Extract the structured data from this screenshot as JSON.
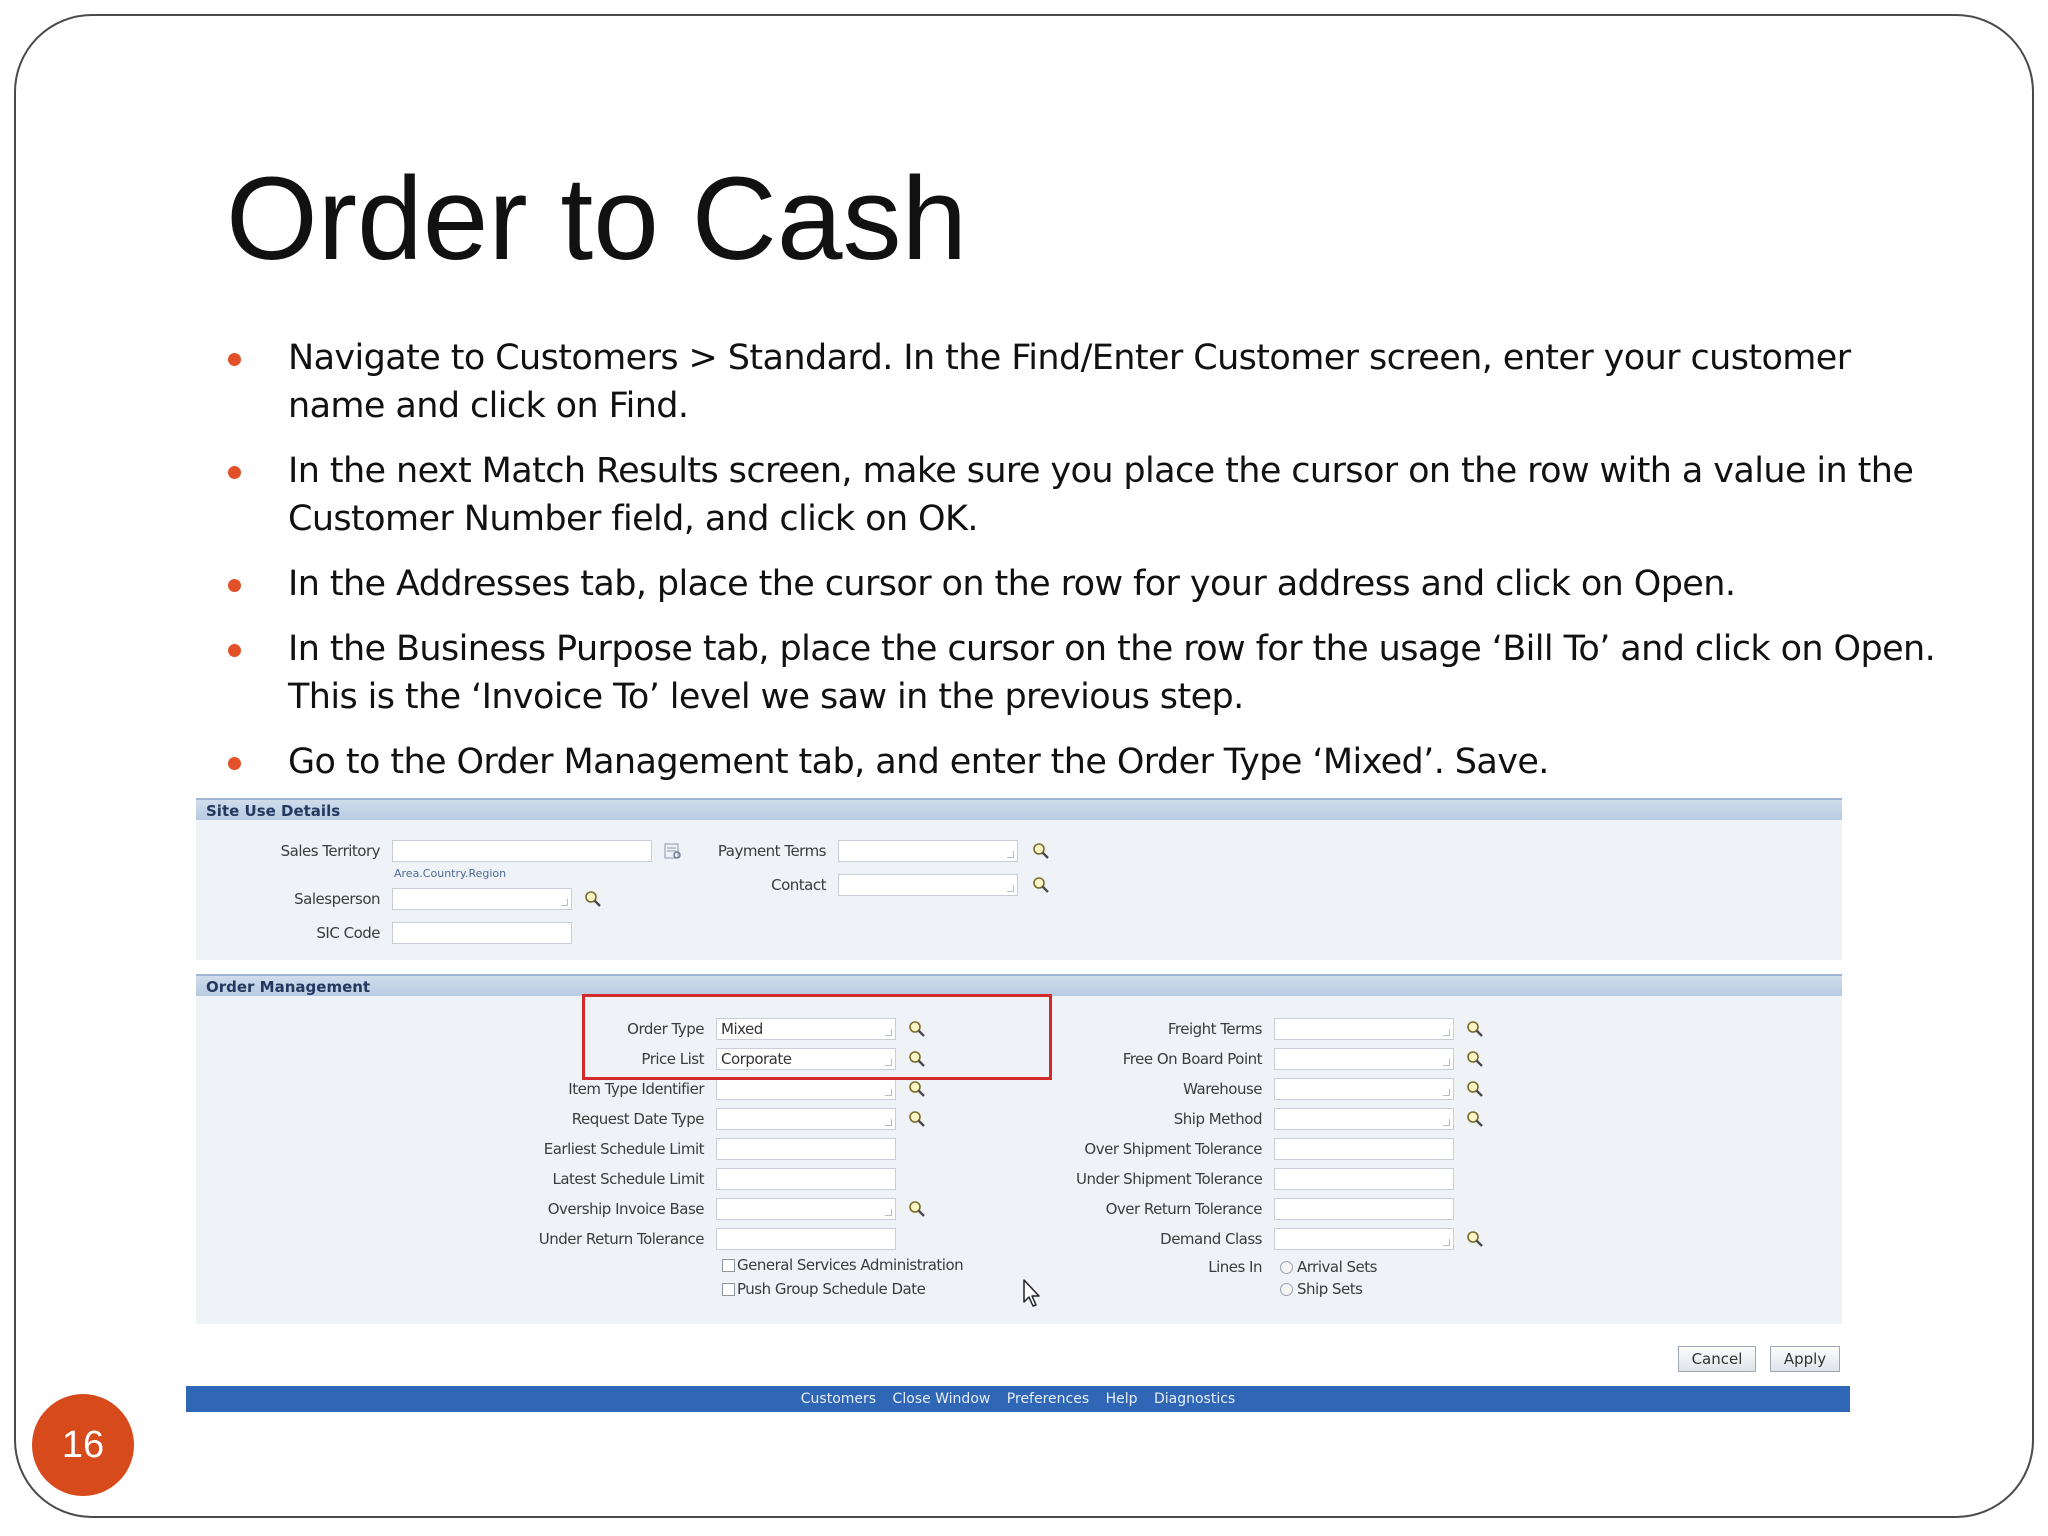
{
  "slide": {
    "title": "Order to Cash",
    "page_number": "16",
    "bullets": [
      "Navigate to Customers > Standard. In the Find/Enter Customer screen, enter your customer name and click on Find.",
      "In the next Match Results screen, make sure you place the cursor on the row with a value in the Customer Number field, and click on OK.",
      "In the Addresses tab, place the cursor on the row for your address and click on Open.",
      "In the Business Purpose tab, place the cursor on the row for the usage ‘Bill To’ and click on Open. This is the ‘Invoice To’ level we saw in the previous step.",
      "Go to the Order Management tab, and enter the Order Type ‘Mixed’. Save."
    ],
    "bullet_color": "#e2512a"
  },
  "site_use": {
    "header": "Site Use Details",
    "sales_territory_label": "Sales Territory",
    "sales_territory_hint": "Area.Country.Region",
    "salesperson_label": "Salesperson",
    "sic_code_label": "SIC Code",
    "payment_terms_label": "Payment Terms",
    "contact_label": "Contact"
  },
  "order_mgmt": {
    "header": "Order Management",
    "order_type_label": "Order Type",
    "order_type_value": "Mixed",
    "price_list_label": "Price List",
    "price_list_value": "Corporate",
    "item_type_label": "Item Type Identifier",
    "request_date_label": "Request Date Type",
    "earliest_label": "Earliest Schedule Limit",
    "latest_label": "Latest Schedule Limit",
    "overship_label": "Overship Invoice Base",
    "under_return_label": "Under Return Tolerance",
    "gsa_label": "General Services Administration",
    "push_group_label": "Push Group Schedule Date",
    "freight_label": "Freight Terms",
    "fob_label": "Free On Board Point",
    "warehouse_label": "Warehouse",
    "ship_method_label": "Ship Method",
    "over_ship_tol_label": "Over Shipment Tolerance",
    "under_ship_tol_label": "Under Shipment Tolerance",
    "over_return_label": "Over Return Tolerance",
    "demand_class_label": "Demand Class",
    "lines_in_label": "Lines In",
    "arrival_sets_label": "Arrival Sets",
    "ship_sets_label": "Ship Sets"
  },
  "buttons": {
    "cancel": "Cancel",
    "apply": "Apply"
  },
  "footer_links": [
    "Customers",
    "Close Window",
    "Preferences",
    "Help",
    "Diagnostics"
  ],
  "colors": {
    "highlight": "#d42a2a",
    "footer": "#2f66b5",
    "page_badge": "#d64a1c"
  }
}
